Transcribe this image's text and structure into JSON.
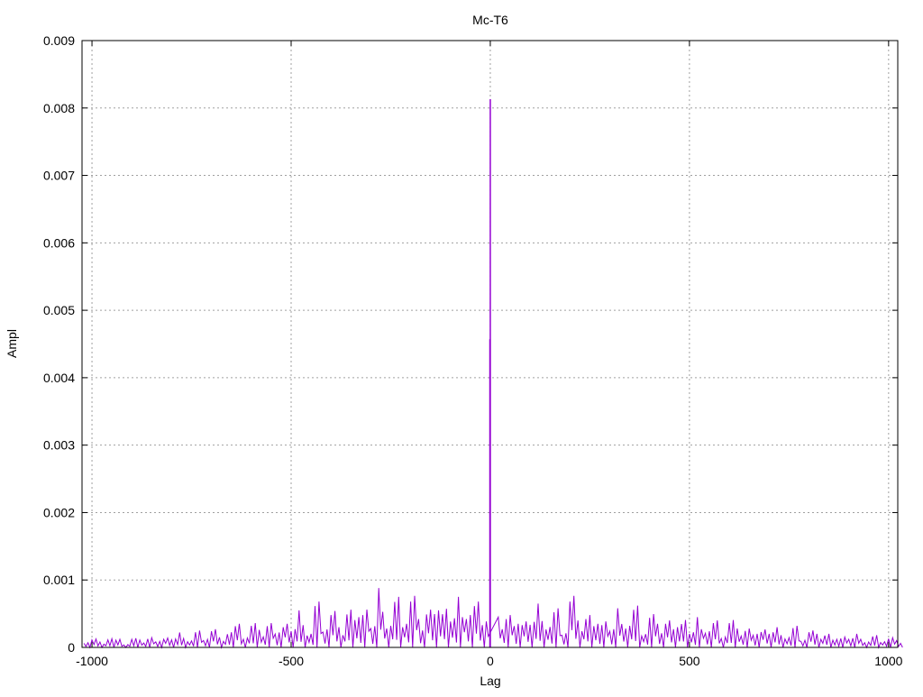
{
  "chart_data": {
    "type": "line",
    "title": "Mc-T6",
    "xlabel": "Lag",
    "ylabel": "Ampl",
    "xlim": [
      -1025,
      1023
    ],
    "ylim": [
      0,
      0.009
    ],
    "grid": true,
    "line_color": "#9400d3",
    "x_ticks": [
      -1000,
      -500,
      0,
      500,
      1000
    ],
    "x_tick_labels": [
      "-1000",
      "-500",
      "0",
      "500",
      "1000"
    ],
    "y_ticks": [
      0,
      0.001,
      0.002,
      0.003,
      0.004,
      0.005,
      0.006,
      0.007,
      0.008,
      0.009
    ],
    "y_tick_labels": [
      "0",
      "0.001",
      "0.002",
      "0.003",
      "0.004",
      "0.005",
      "0.006",
      "0.007",
      "0.008",
      "0.009"
    ],
    "series": [
      {
        "name": "Mc-T6",
        "x_start": -1020,
        "x_step": 20,
        "values": [
          0.0001,
          0.00014,
          8e-05,
          0.00016,
          0.00012,
          6e-05,
          0.00015,
          0.00011,
          0.00018,
          9e-05,
          0.0002,
          0.00014,
          0.00022,
          0.00012,
          0.00025,
          0.00017,
          0.0003,
          0.00015,
          0.00028,
          0.00035,
          0.0002,
          0.0004,
          0.00026,
          0.00045,
          0.00022,
          0.0005,
          0.0003,
          0.00055,
          0.00025,
          0.00068,
          0.00038,
          0.0006,
          0.0003,
          0.0007,
          0.00045,
          0.0008,
          0.00035,
          0.00088,
          0.0004,
          0.00075,
          0.0005,
          0.00085,
          0.00042,
          0.0007,
          0.00055,
          0.00082,
          0.00048,
          0.00075,
          0.0006,
          0.00068,
          0.00055,
          0.00812,
          0.00045,
          0.0006,
          0.00035,
          0.00055,
          0.00042,
          0.00065,
          0.00038,
          0.00058,
          0.0003,
          0.00085,
          0.0004,
          0.0006,
          0.00035,
          0.00055,
          0.0003,
          0.00058,
          0.0004,
          0.00062,
          0.00028,
          0.00055,
          0.00035,
          0.0005,
          0.0003,
          0.00058,
          0.00025,
          0.00045,
          0.0003,
          0.0004,
          0.00022,
          0.00045,
          0.00028,
          0.00035,
          0.0002,
          0.00038,
          0.00025,
          0.0003,
          0.00018,
          0.00032,
          0.00015,
          0.00028,
          0.0002,
          0.00025,
          0.00012,
          0.00022,
          0.00015,
          0.0002,
          0.0001,
          0.00018,
          0.00012,
          0.00016,
          0.0001
        ]
      }
    ],
    "peaks": [
      {
        "x": 0,
        "y": 0.00813
      },
      {
        "x": -1,
        "y": 0.00457
      }
    ]
  }
}
